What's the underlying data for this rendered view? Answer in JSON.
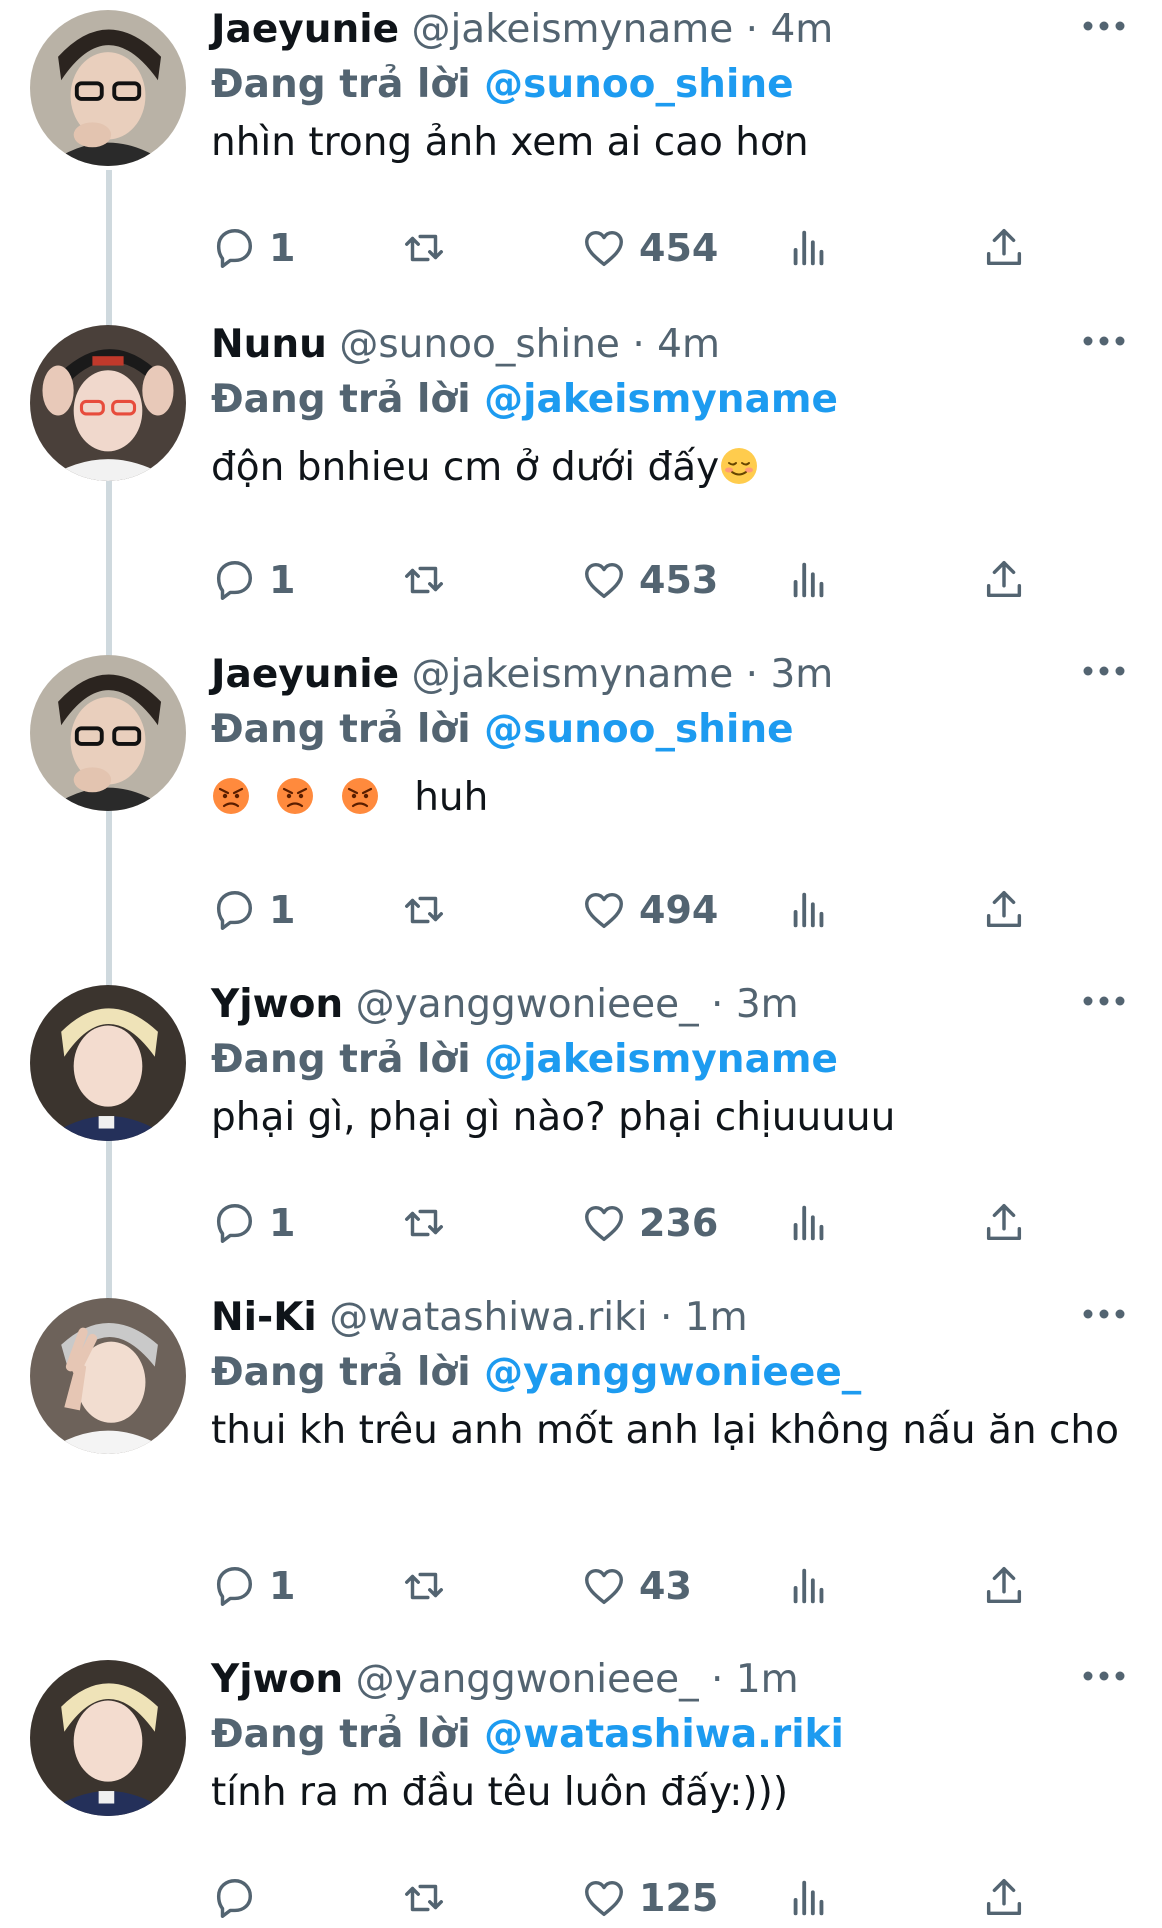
{
  "reply_prefix": "Đang trả lời",
  "tweets": [
    {
      "name": "Jaeyunie",
      "handle": "@jakeismyname",
      "sep": "·",
      "time": "4m",
      "reply_to": "@sunoo_shine",
      "text": "nhìn trong ảnh xem ai cao hơn",
      "replies": "1",
      "likes": "454"
    },
    {
      "name": "Nunu",
      "handle": "@sunoo_shine",
      "sep": "·",
      "time": "4m",
      "reply_to": "@jakeismyname",
      "text": "độn bnhieu cm ở dưới đấy",
      "replies": "1",
      "likes": "453"
    },
    {
      "name": "Jaeyunie",
      "handle": "@jakeismyname",
      "sep": "·",
      "time": "3m",
      "reply_to": "@sunoo_shine",
      "text": "huh",
      "replies": "1",
      "likes": "494"
    },
    {
      "name": "Yjwon",
      "handle": "@yanggwonieee_",
      "sep": "·",
      "time": "3m",
      "reply_to": "@jakeismyname",
      "text": "phại gì, phại gì nào? phại chịuuuuu",
      "replies": "1",
      "likes": "236"
    },
    {
      "name": "Ni-Ki",
      "handle": "@watashiwa.riki",
      "sep": "·",
      "time": "1m",
      "reply_to": "@yanggwonieee_",
      "text": "thui kh trêu anh mốt anh lại không nấu ăn cho",
      "replies": "1",
      "likes": "43"
    },
    {
      "name": "Yjwon",
      "handle": "@yanggwonieee_",
      "sep": "·",
      "time": "1m",
      "reply_to": "@watashiwa.riki",
      "text": "tính ra m đầu têu luôn đấy:)))",
      "replies": "",
      "likes": "125"
    }
  ],
  "icons": {
    "reply": "reply-icon",
    "retweet": "retweet-icon",
    "like": "heart-icon",
    "views": "views-icon",
    "share": "share-icon",
    "more": "more-icon"
  },
  "colors": {
    "accent": "#1d9bf0",
    "muted": "#536471",
    "text": "#0f1419"
  }
}
